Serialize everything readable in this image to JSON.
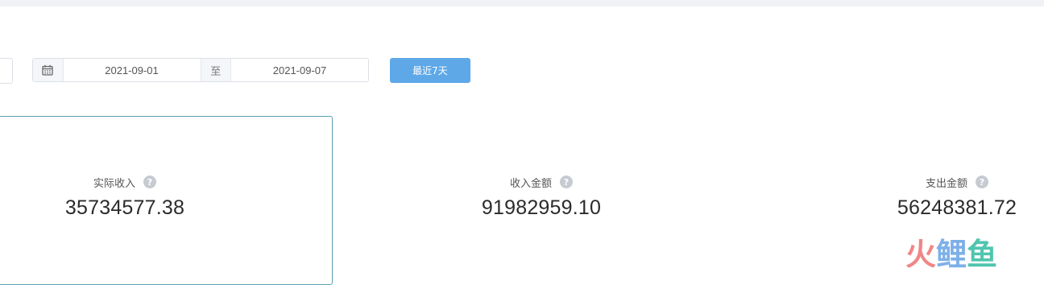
{
  "filters": {
    "start_date": "2021-09-01",
    "separator": "至",
    "end_date": "2021-09-07",
    "recent_button": "最近7天"
  },
  "stats": [
    {
      "label": "实际收入",
      "help": "?",
      "value": "35734577.38"
    },
    {
      "label": "收入金额",
      "help": "?",
      "value": "91982959.10"
    },
    {
      "label": "支出金额",
      "help": "?",
      "value": "56248381.72"
    }
  ],
  "watermark": {
    "chars": [
      "火",
      "鲤",
      "鱼"
    ],
    "colors": [
      "#f07a7a",
      "#6fa8e6",
      "#3fbfa6"
    ]
  },
  "colors": {
    "accent": "#5ea8e8",
    "selected_border": "#5a9fb4"
  }
}
